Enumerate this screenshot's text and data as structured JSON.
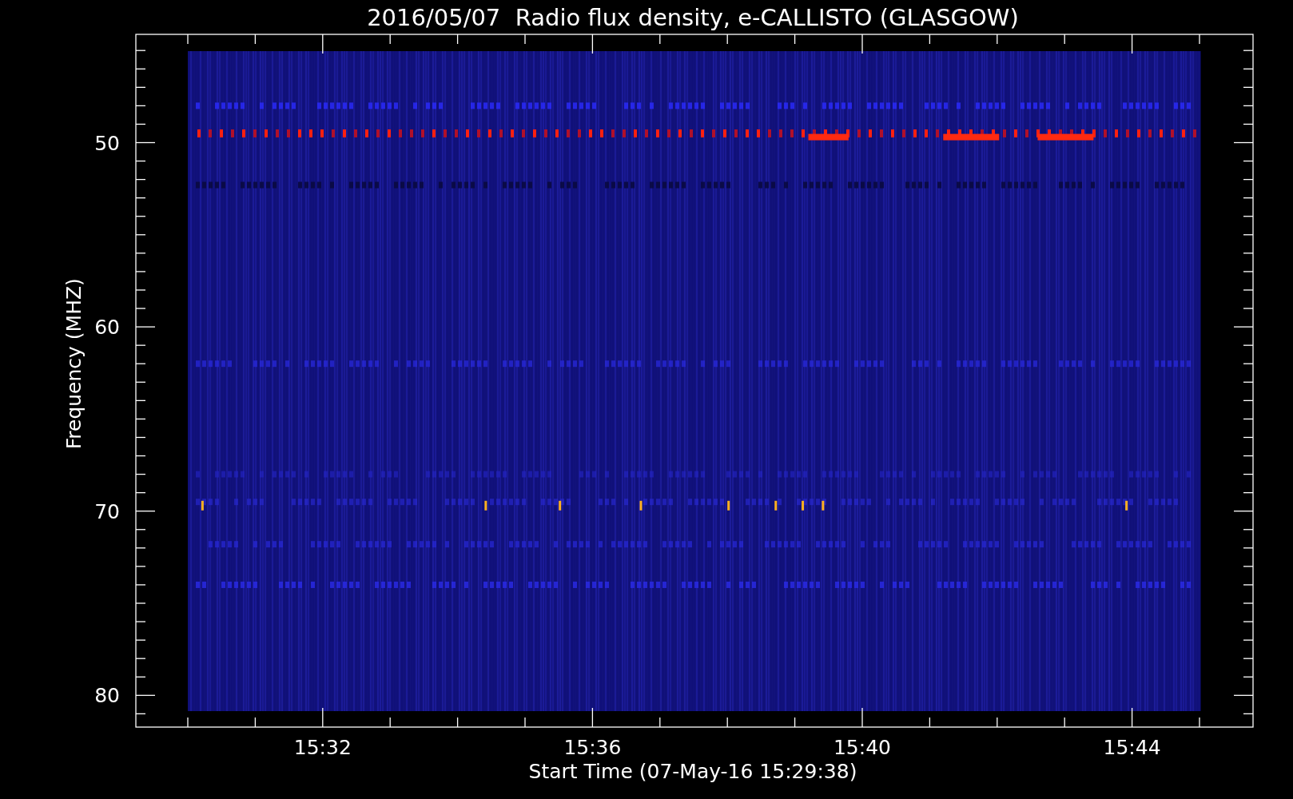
{
  "title": "2016/05/07  Radio flux density, e-CALLISTO (GLASGOW)",
  "y_axis": {
    "label": "Frequency (MHZ)",
    "ticks": [
      "50",
      "60",
      "70",
      "80"
    ]
  },
  "x_axis": {
    "label": "Start Time (07-May-16 15:29:38)",
    "ticks": [
      "15:32",
      "15:36",
      "15:40",
      "15:44"
    ]
  }
}
